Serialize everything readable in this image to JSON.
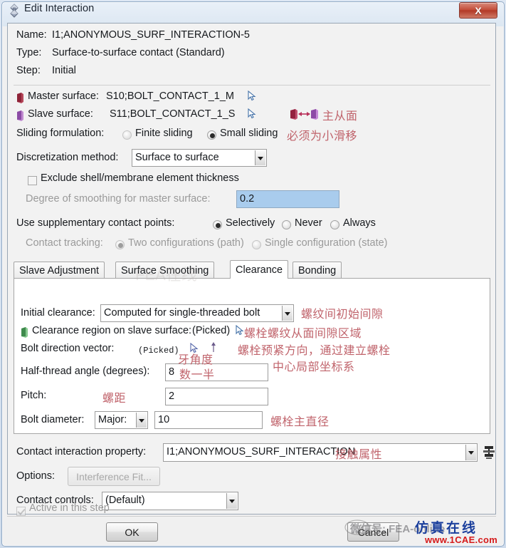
{
  "window": {
    "title": "Edit Interaction",
    "icon": "abaqus-diamond-icon",
    "close_label": "X"
  },
  "header": {
    "name_label": "Name:",
    "name_value": "I1;ANONYMOUS_SURF_INTERACTION-5",
    "type_label": "Type:",
    "type_value": "Surface-to-surface contact (Standard)",
    "step_label": "Step:",
    "step_value": "Initial"
  },
  "surfaces": {
    "master_label": "Master surface:",
    "master_value": "S10;BOLT_CONTACT_1_M",
    "slave_label": "Slave surface:",
    "slave_value": "S11;BOLT_CONTACT_1_S"
  },
  "sliding": {
    "label": "Sliding formulation:",
    "options": [
      "Finite sliding",
      "Small sliding"
    ],
    "selected": "Small sliding"
  },
  "discretization": {
    "label": "Discretization method:",
    "value": "Surface to surface"
  },
  "exclude_thickness": {
    "label": "Exclude shell/membrane element thickness",
    "checked": false
  },
  "smoothing": {
    "label": "Degree of smoothing for master surface:",
    "value": "0.2"
  },
  "supplementary": {
    "label": "Use supplementary contact points:",
    "options": [
      "Selectively",
      "Never",
      "Always"
    ],
    "selected": "Selectively"
  },
  "contact_tracking": {
    "label": "Contact tracking:",
    "options": [
      "Two configurations (path)",
      "Single configuration (state)"
    ],
    "selected": "Two configurations (path)"
  },
  "tabs": {
    "items": [
      "Slave Adjustment",
      "Surface Smoothing",
      "Clearance",
      "Bonding"
    ],
    "active": "Clearance"
  },
  "clearance": {
    "initial_label": "Initial clearance:",
    "initial_value": "Computed for single-threaded bolt",
    "region_label": "Clearance region on slave surface:",
    "region_value": "(Picked)",
    "bolt_dir_label": "Bolt direction vector:",
    "bolt_dir_value": "(Picked)",
    "half_angle_label": "Half-thread angle (degrees):",
    "half_angle_value": "8",
    "pitch_label": "Pitch:",
    "pitch_value": "2",
    "diameter_label": "Bolt diameter:",
    "diameter_kind": "Major:",
    "diameter_value": "10"
  },
  "bottom": {
    "property_label": "Contact interaction property:",
    "property_value": "I1;ANONYMOUS_SURF_INTERACTION",
    "create_icon": "create-interaction-property-icon",
    "options_label": "Options:",
    "options_button": "Interference Fit...",
    "controls_label": "Contact controls:",
    "controls_value": "(Default)",
    "active_label": "Active in this step",
    "active_checked": true
  },
  "footer": {
    "ok_label": "OK",
    "cancel_label": "Cancel"
  },
  "annotations": {
    "master_slave": "主从面",
    "small_sliding": "必须为小滑移",
    "initial_clearance": "螺纹间初始间隙",
    "clearance_region": "螺栓螺纹从面间隙区域",
    "bolt_direction_l1": "螺栓预紧方向，通过建立螺栓",
    "bolt_direction_l2": "中心局部坐标系",
    "half_angle_l1": "牙角度",
    "half_angle_l2": "数一半",
    "pitch": "螺距",
    "diameter": "螺栓主直径",
    "contact_property": "接触属性"
  },
  "watermark": {
    "logo": "微信号: FEA-online",
    "cn": "仿真在线",
    "url": "www.1CAE.com",
    "ghost": "FEA在线"
  },
  "colors": {
    "annotation": "#c0636b",
    "selected_field": "#a9cced",
    "watermark_blue": "#1b3f9c",
    "watermark_red": "#d51a1a",
    "close_red": "#b33a27"
  }
}
